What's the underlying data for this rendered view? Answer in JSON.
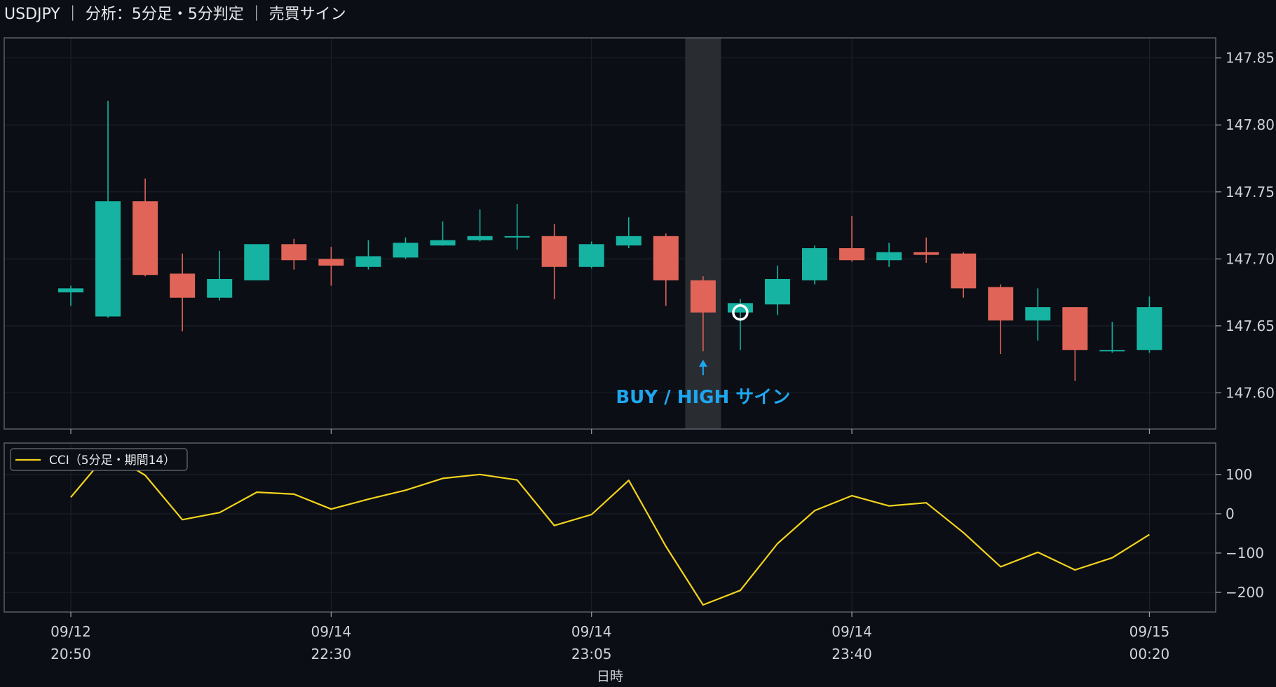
{
  "header": {
    "title": "USDJPY ｜ 分析：5分足・5分判定 ｜ 売買サイン"
  },
  "colors": {
    "background": "#0b0e14",
    "up": "#16b3a2",
    "down": "#e06458",
    "cci_line": "#f4d41c",
    "signal": "#1ea7f0",
    "grid": "#1e232c",
    "frame": "#5a5f68"
  },
  "chart_data": [
    {
      "type": "candlestick",
      "ylim": [
        147.573,
        147.865
      ],
      "yticks": [
        147.6,
        147.65,
        147.7,
        147.75,
        147.8,
        147.85
      ],
      "ytick_labels": [
        "147.60",
        "147.65",
        "147.70",
        "147.75",
        "147.80",
        "147.85"
      ],
      "grid": true,
      "candles": [
        {
          "o": 147.675,
          "h": 147.68,
          "l": 147.665,
          "c": 147.678
        },
        {
          "o": 147.657,
          "h": 147.818,
          "l": 147.656,
          "c": 147.743
        },
        {
          "o": 147.743,
          "h": 147.76,
          "l": 147.687,
          "c": 147.688
        },
        {
          "o": 147.689,
          "h": 147.704,
          "l": 147.646,
          "c": 147.671
        },
        {
          "o": 147.671,
          "h": 147.706,
          "l": 147.669,
          "c": 147.685
        },
        {
          "o": 147.684,
          "h": 147.711,
          "l": 147.684,
          "c": 147.711
        },
        {
          "o": 147.711,
          "h": 147.715,
          "l": 147.692,
          "c": 147.699
        },
        {
          "o": 147.7,
          "h": 147.709,
          "l": 147.68,
          "c": 147.695
        },
        {
          "o": 147.694,
          "h": 147.714,
          "l": 147.692,
          "c": 147.702
        },
        {
          "o": 147.701,
          "h": 147.716,
          "l": 147.7,
          "c": 147.712
        },
        {
          "o": 147.71,
          "h": 147.728,
          "l": 147.71,
          "c": 147.714
        },
        {
          "o": 147.714,
          "h": 147.737,
          "l": 147.713,
          "c": 147.717
        },
        {
          "o": 147.717,
          "h": 147.741,
          "l": 147.707,
          "c": 147.717
        },
        {
          "o": 147.717,
          "h": 147.726,
          "l": 147.67,
          "c": 147.694
        },
        {
          "o": 147.694,
          "h": 147.713,
          "l": 147.693,
          "c": 147.711
        },
        {
          "o": 147.71,
          "h": 147.731,
          "l": 147.708,
          "c": 147.717
        },
        {
          "o": 147.717,
          "h": 147.719,
          "l": 147.665,
          "c": 147.684
        },
        {
          "o": 147.684,
          "h": 147.687,
          "l": 147.631,
          "c": 147.66
        },
        {
          "o": 147.66,
          "h": 147.67,
          "l": 147.632,
          "c": 147.667
        },
        {
          "o": 147.666,
          "h": 147.695,
          "l": 147.658,
          "c": 147.685
        },
        {
          "o": 147.684,
          "h": 147.71,
          "l": 147.681,
          "c": 147.708
        },
        {
          "o": 147.708,
          "h": 147.732,
          "l": 147.698,
          "c": 147.699
        },
        {
          "o": 147.699,
          "h": 147.712,
          "l": 147.694,
          "c": 147.705
        },
        {
          "o": 147.705,
          "h": 147.716,
          "l": 147.697,
          "c": 147.703
        },
        {
          "o": 147.704,
          "h": 147.705,
          "l": 147.671,
          "c": 147.678
        },
        {
          "o": 147.679,
          "h": 147.681,
          "l": 147.629,
          "c": 147.654
        },
        {
          "o": 147.654,
          "h": 147.678,
          "l": 147.639,
          "c": 147.664
        },
        {
          "o": 147.664,
          "h": 147.664,
          "l": 147.609,
          "c": 147.632
        },
        {
          "o": 147.631,
          "h": 147.653,
          "l": 147.63,
          "c": 147.632
        },
        {
          "o": 147.632,
          "h": 147.672,
          "l": 147.63,
          "c": 147.664
        }
      ],
      "highlight_candle": 17,
      "signal": {
        "candle": 17,
        "label": "BUY / HIGH サイン"
      },
      "marker": {
        "candle": 18,
        "value": 147.66,
        "shape": "circle"
      }
    },
    {
      "type": "line",
      "series": [
        {
          "name": "CCI（5分足・期間14）",
          "values": [
            42,
            155,
            98,
            -15,
            3,
            55,
            50,
            12,
            37,
            60,
            90,
            100,
            86,
            -30,
            -2,
            85,
            -83,
            -232,
            -195,
            -76,
            8,
            46,
            20,
            28,
            -48,
            -135,
            -98,
            -143,
            -112,
            -53
          ]
        }
      ],
      "ylim": [
        -250,
        180
      ],
      "yticks": [
        -200,
        -100,
        0,
        100
      ],
      "ytick_labels": [
        "−200",
        "−100",
        "0",
        "100"
      ],
      "legend": "top-left",
      "grid": true
    }
  ],
  "x_axis": {
    "label": "日時",
    "ticks": [
      {
        "candle": 0,
        "date": "09/12",
        "time": "20:50"
      },
      {
        "candle": 7,
        "date": "09/14",
        "time": "22:30"
      },
      {
        "candle": 14,
        "date": "09/14",
        "time": "23:05"
      },
      {
        "candle": 21,
        "date": "09/14",
        "time": "23:40"
      },
      {
        "candle": 29,
        "date": "09/15",
        "time": "00:20"
      }
    ]
  }
}
